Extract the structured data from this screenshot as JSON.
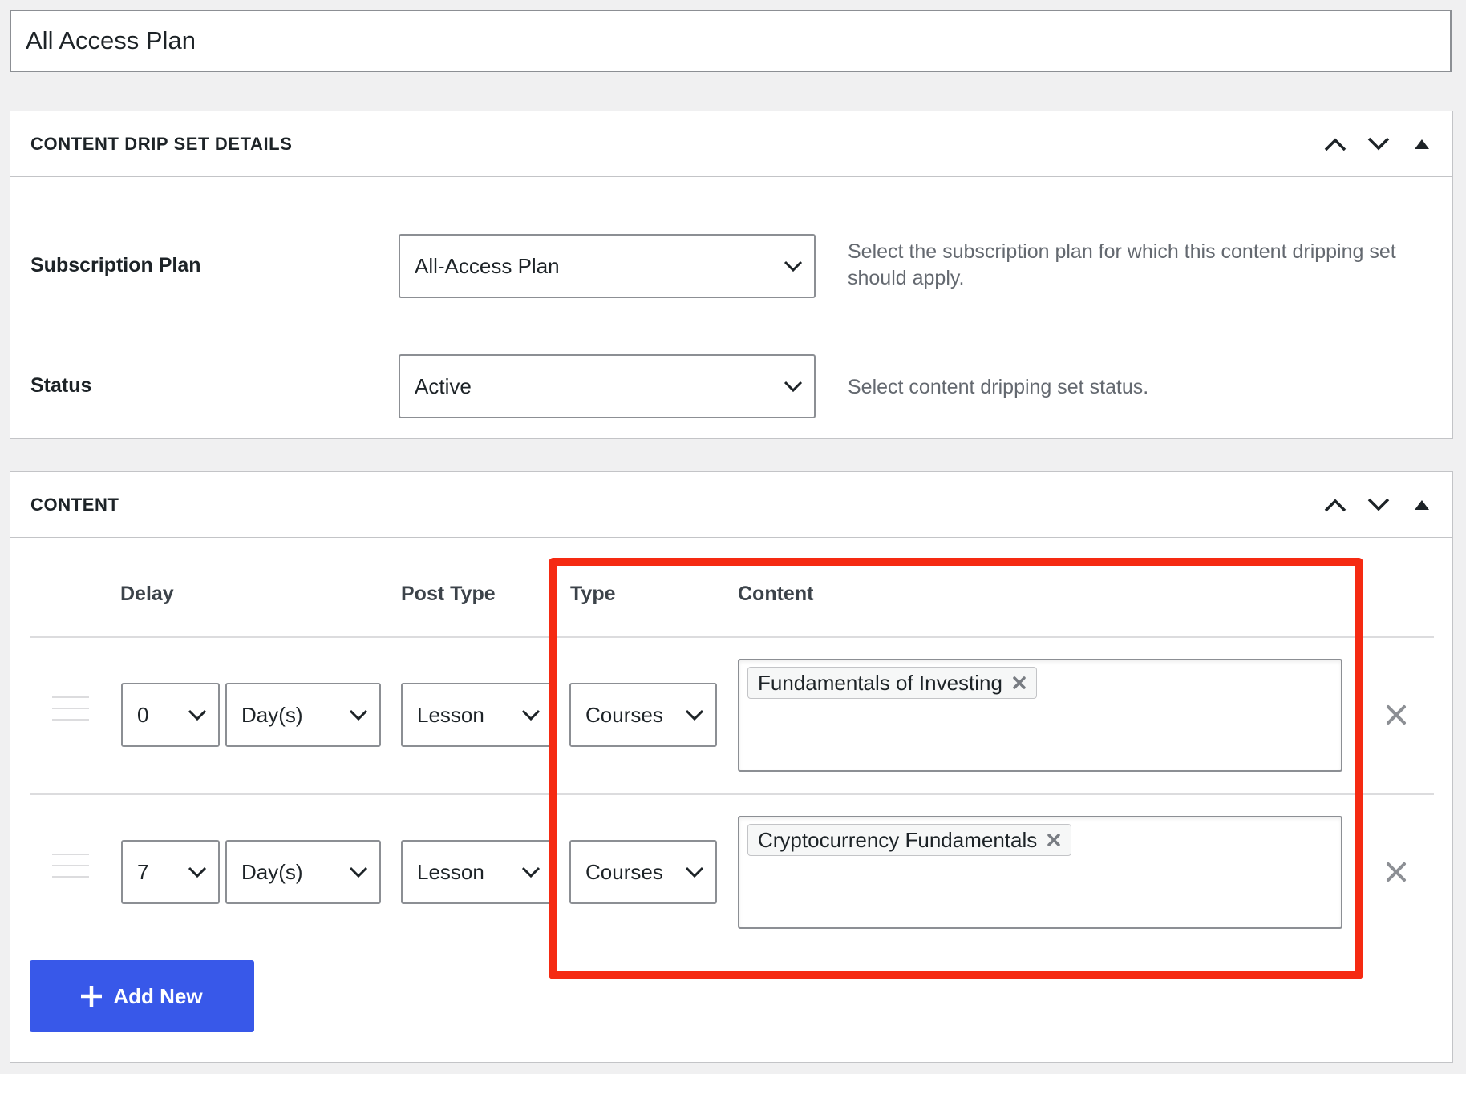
{
  "title_field": {
    "value": "All Access Plan"
  },
  "details_panel": {
    "heading": "CONTENT DRIP SET DETAILS",
    "subscription_plan": {
      "label": "Subscription Plan",
      "selected": "All-Access Plan",
      "description": "Select the subscription plan for which this content dripping set should apply."
    },
    "status": {
      "label": "Status",
      "selected": "Active",
      "description": "Select content dripping set status."
    }
  },
  "content_panel": {
    "heading": "CONTENT",
    "columns": {
      "delay": "Delay",
      "post_type": "Post Type",
      "type": "Type",
      "content": "Content"
    },
    "rows": [
      {
        "delay_value": "0",
        "delay_unit": "Day(s)",
        "post_type": "Lesson",
        "type": "Courses",
        "content_tags": [
          "Fundamentals of Investing"
        ]
      },
      {
        "delay_value": "7",
        "delay_unit": "Day(s)",
        "post_type": "Lesson",
        "type": "Courses",
        "content_tags": [
          "Cryptocurrency Fundamentals"
        ]
      }
    ],
    "add_new_label": "Add New"
  },
  "colors": {
    "accent_button": "#3858e9",
    "highlight_border": "#f52a12",
    "page_background": "#f0f0f1",
    "border": "#8c8f94"
  },
  "icons": {
    "move_up": "chevron-up-icon",
    "move_down": "chevron-down-icon",
    "toggle": "triangle-up-icon",
    "remove_row": "close-icon",
    "remove_tag": "close-icon",
    "add": "plus-icon",
    "drag": "drag-handle-icon"
  }
}
